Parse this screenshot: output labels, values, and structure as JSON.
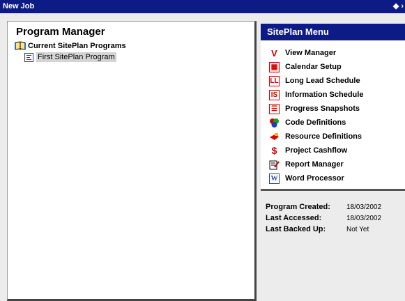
{
  "window": {
    "title": "New Job"
  },
  "program_manager": {
    "title": "Program Manager",
    "root_label": "Current SitePlan Programs",
    "child_label": "First SitePlan Program"
  },
  "siteplan_menu": {
    "title": "SitePlan Menu",
    "items": [
      {
        "label": "View Manager",
        "icon": "view-manager-icon"
      },
      {
        "label": "Calendar Setup",
        "icon": "calendar-icon"
      },
      {
        "label": "Long Lead Schedule",
        "icon": "long-lead-icon"
      },
      {
        "label": "Information Schedule",
        "icon": "information-schedule-icon"
      },
      {
        "label": "Progress Snapshots",
        "icon": "progress-snapshot-icon"
      },
      {
        "label": "Code Definitions",
        "icon": "code-definitions-icon"
      },
      {
        "label": "Resource Definitions",
        "icon": "resource-definitions-icon"
      },
      {
        "label": "Project Cashflow",
        "icon": "dollar-icon"
      },
      {
        "label": "Report Manager",
        "icon": "report-manager-icon"
      },
      {
        "label": "Word Processor",
        "icon": "word-icon"
      }
    ]
  },
  "info": {
    "created_label": "Program Created:",
    "created_value": "18/03/2002",
    "accessed_label": "Last Accessed:",
    "accessed_value": "18/03/2002",
    "backed_label": "Last Backed Up:",
    "backed_value": "Not Yet"
  },
  "colors": {
    "titlebar": "#0d1b86",
    "panel_bg": "#ececec"
  }
}
